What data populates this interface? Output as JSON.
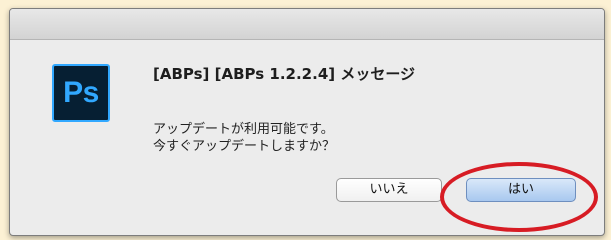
{
  "dialog": {
    "app_icon_text": "Ps",
    "title": "[ABPs] [ABPs 1.2.2.4] メッセージ",
    "body_lines": [
      "アップデートが利用可能です。",
      "今すぐアップデートしますか？"
    ],
    "buttons": {
      "no_label": "いいえ",
      "yes_label": "はい"
    }
  },
  "colors": {
    "icon_background": "#061f33",
    "icon_accent": "#31a8ff",
    "highlight_ring": "#d71c24",
    "default_button": "#a8c8ef"
  }
}
